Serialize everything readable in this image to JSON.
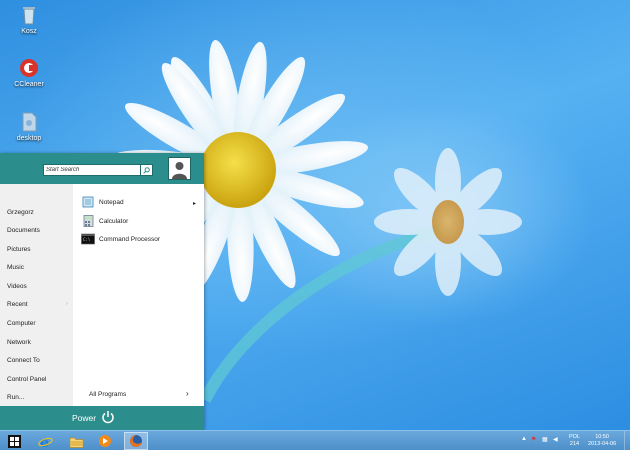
{
  "desktop": {
    "icons": [
      {
        "label": "Kosz",
        "icon": "recycle-bin-icon"
      },
      {
        "label": "CCleaner",
        "icon": "ccleaner-icon"
      },
      {
        "label": "desktop",
        "icon": "file-icon"
      }
    ]
  },
  "start_menu": {
    "search_placeholder": "Start Search",
    "user_avatar_icon": "user-avatar-icon",
    "left_items": [
      "Grzegorz",
      "Documents",
      "Pictures",
      "Music",
      "Videos",
      "Recent",
      "Computer",
      "Network",
      "Connect To",
      "Control Panel",
      "Run..."
    ],
    "apps": [
      {
        "label": "Notepad",
        "icon": "notepad-icon"
      },
      {
        "label": "Calculator",
        "icon": "calculator-icon"
      },
      {
        "label": "Command Processor",
        "icon": "command-prompt-icon"
      }
    ],
    "all_programs": "All Programs",
    "power_label": "Power"
  },
  "taskbar": {
    "pinned": [
      "windows-start-icon",
      "internet-explorer-icon",
      "file-explorer-icon",
      "media-player-icon",
      "firefox-icon"
    ],
    "tray": {
      "language": "POL",
      "language_sub": "214",
      "time": "10:50",
      "date": "2013-04-06"
    }
  },
  "colors": {
    "accent": "#2b8d8c",
    "taskbar": "#5a9ad3",
    "desktop": "#3b9be6"
  }
}
